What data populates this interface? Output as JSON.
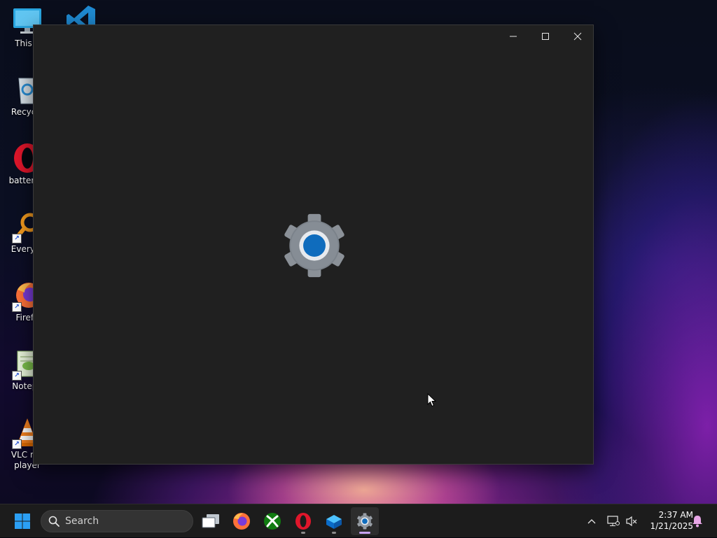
{
  "desktop": {
    "icons": [
      {
        "label": "This P",
        "icon": "computer-icon"
      },
      {
        "label": "Recycle",
        "icon": "recycle-bin-icon"
      },
      {
        "label": "battery-r",
        "icon": "opera-icon"
      },
      {
        "label": "Everyth",
        "icon": "everything-search-icon"
      },
      {
        "label": "Firefo",
        "icon": "firefox-icon"
      },
      {
        "label": "Notepa",
        "icon": "notepad-plus-plus-icon"
      },
      {
        "label": "VLC me",
        "label2": "player",
        "icon": "vlc-icon"
      },
      {
        "label": "",
        "icon": "vscode-icon"
      }
    ]
  },
  "window": {
    "app": "Settings",
    "splash_icon": "settings-gear-icon",
    "controls": [
      "minimize",
      "maximize",
      "close"
    ]
  },
  "taskbar": {
    "search_placeholder": "Search",
    "pinned": [
      {
        "name": "task-view",
        "icon": "task-view-icon"
      },
      {
        "name": "firefox",
        "icon": "firefox-icon"
      },
      {
        "name": "xbox",
        "icon": "xbox-icon"
      },
      {
        "name": "opera",
        "icon": "opera-icon"
      },
      {
        "name": "app",
        "icon": "blue-box-icon"
      },
      {
        "name": "settings",
        "icon": "settings-gear-icon",
        "active": true
      }
    ],
    "clock": {
      "time": "2:37 AM",
      "date": "1/21/2025"
    }
  },
  "colors": {
    "window_bg": "#202020",
    "taskbar_bg": "#1c1c1c",
    "accent": "#0f6cbd"
  }
}
